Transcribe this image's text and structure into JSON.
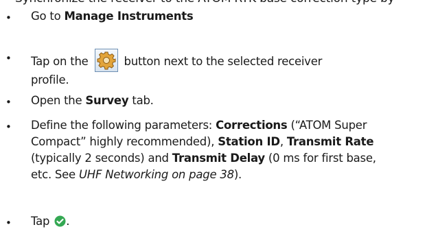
{
  "top_cutoff_line": "Synchronize the receiver to the ATOM RTK base correction type by",
  "steps": [
    {
      "pre": "Go to ",
      "bold": "Manage Instruments"
    },
    {
      "pre": "Tap on the ",
      "post": " button next to the selected receiver",
      "line2": "profile."
    },
    {
      "pre": "Open the ",
      "bold": "Survey",
      "post": " tab."
    },
    {
      "pre": "Define the following parameters: ",
      "b1": "Corrections",
      "t1": " (“ATOM Super",
      "t2": "Compact” highly recommended), ",
      "b2": "Station ID",
      "t3": ", ",
      "b3": "Transmit Rate",
      "t4": "(typically 2 seconds) and ",
      "b4": "Transmit Delay",
      "t5": " (0 ms for first base,",
      "t6": "etc. See ",
      "ref": "UHF Networking on page 38",
      "t7": ")."
    },
    {
      "pre": "Tap ",
      "post": "."
    }
  ],
  "icons": {
    "gear": "gear-icon",
    "check": "check-circle-icon",
    "gear_color": "#e2a43a",
    "check_color": "#34a853"
  }
}
